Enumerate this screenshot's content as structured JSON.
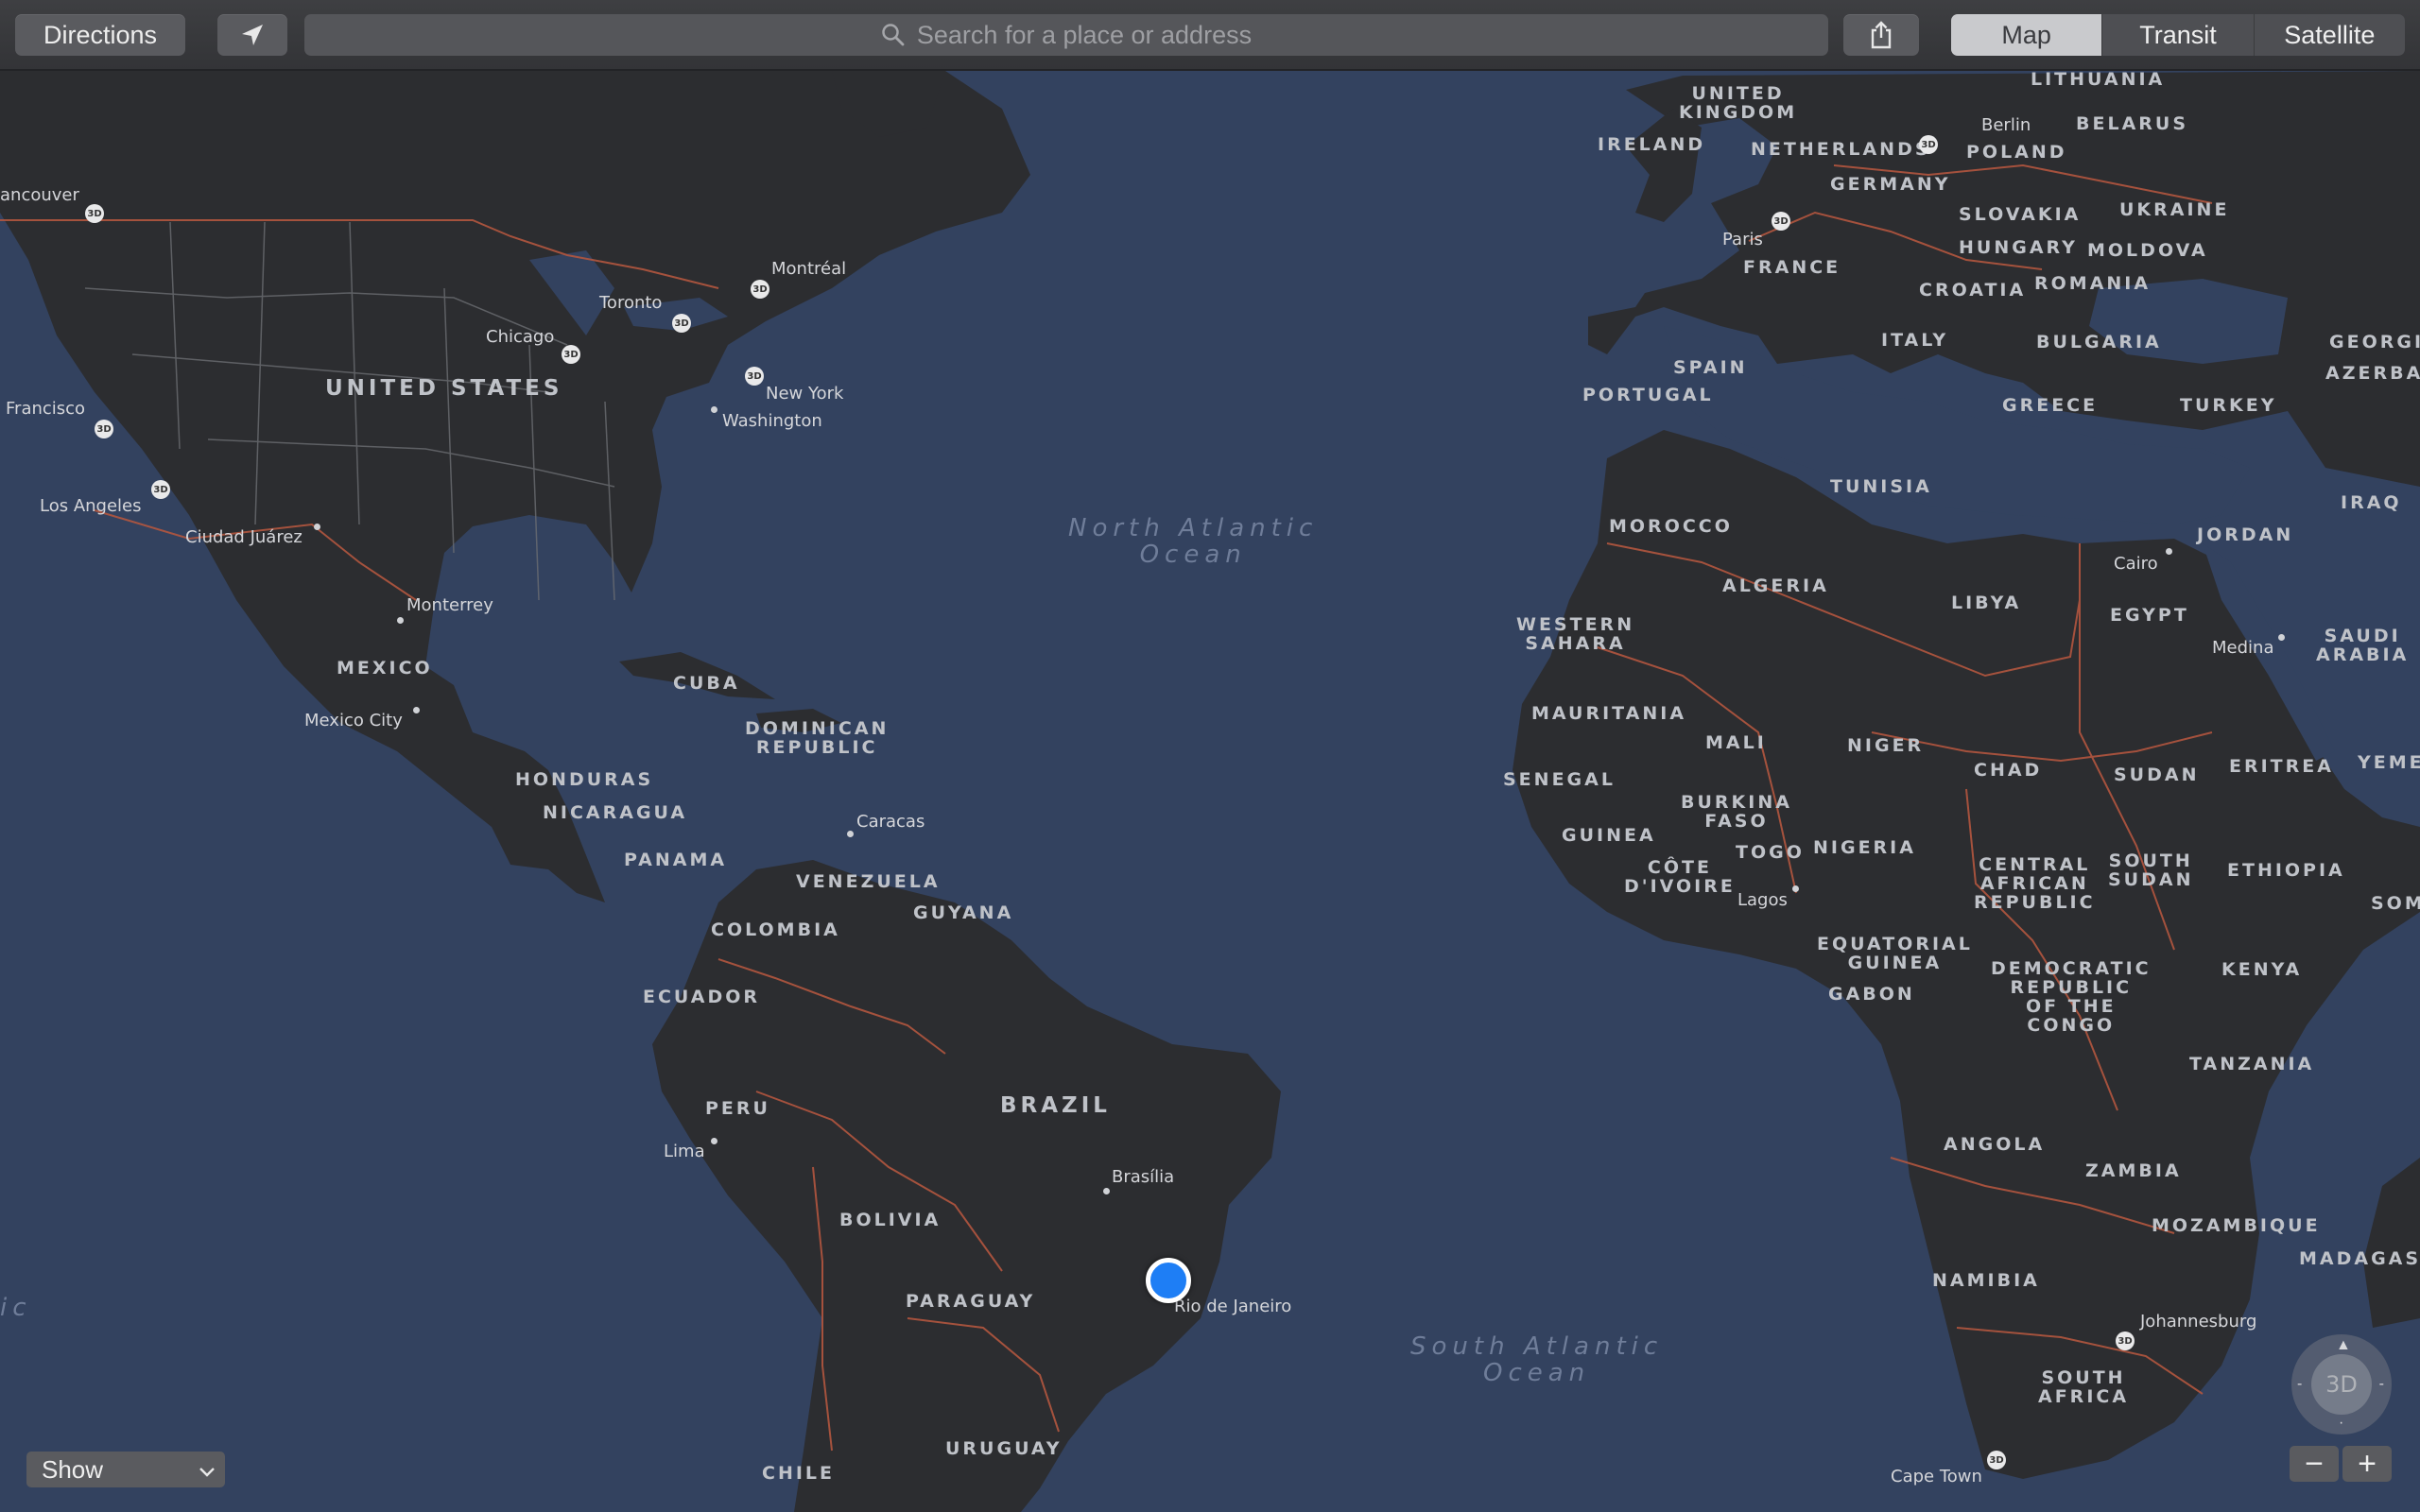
{
  "toolbar": {
    "directions_label": "Directions",
    "search_placeholder": "Search for a place or address",
    "map_types": [
      {
        "label": "Map",
        "active": true
      },
      {
        "label": "Transit",
        "active": false
      },
      {
        "label": "Satellite",
        "active": false
      }
    ],
    "icons": {
      "location": "location-arrow-icon",
      "search": "magnifier-icon",
      "share": "share-icon"
    }
  },
  "map": {
    "colors": {
      "ocean": "#33425f",
      "land": "#2c2d30",
      "border": "#b3563f",
      "user_location": "#1e7ef5"
    },
    "user_location_label": "Rio de Janeiro",
    "oceans": [
      {
        "line1": "North Atlantic",
        "line2": "Ocean"
      },
      {
        "line1": "South Atlantic",
        "line2": "Ocean"
      },
      {
        "fragment": "ic"
      }
    ],
    "countries": [
      "UNITED STATES",
      "MEXICO",
      "CUBA",
      "DOMINICAN",
      "REPUBLIC",
      "HONDURAS",
      "NICARAGUA",
      "PANAMA",
      "VENEZUELA",
      "GUYANA",
      "COLOMBIA",
      "ECUADOR",
      "PERU",
      "BRAZIL",
      "BOLIVIA",
      "PARAGUAY",
      "URUGUAY",
      "CHILE",
      "UNITED",
      "KINGDOM",
      "IRELAND",
      "NETHERLANDS",
      "GERMANY",
      "POLAND",
      "BELARUS",
      "LITHUANIA",
      "FRANCE",
      "SLOVAKIA",
      "UKRAINE",
      "HUNGARY",
      "MOLDOVA",
      "CROATIA",
      "ROMANIA",
      "ITALY",
      "BULGARIA",
      "GEORGIA",
      "AZERBAI",
      "SPAIN",
      "PORTUGAL",
      "GREECE",
      "TURKEY",
      "TUNISIA",
      "MOROCCO",
      "ALGERIA",
      "LIBYA",
      "EGYPT",
      "IRAQ",
      "JORDAN",
      "SAUDI",
      "ARABIA",
      "WESTERN",
      "SAHARA",
      "MAURITANIA",
      "MALI",
      "NIGER",
      "CHAD",
      "SUDAN",
      "ERITREA",
      "YEMEN",
      "SENEGAL",
      "BURKINA",
      "FASO",
      "GUINEA",
      "CÔTE",
      "D'IVOIRE",
      "TOGO",
      "NIGERIA",
      "CENTRAL",
      "AFRICAN",
      "REPUBLIC",
      "SOUTH",
      "SUDAN",
      "ETHIOPIA",
      "SOMALI",
      "EQUATORIAL",
      "GUINEA",
      "GABON",
      "DEMOCRATIC",
      "REPUBLIC",
      "OF THE",
      "CONGO",
      "KENYA",
      "TANZANIA",
      "ANGOLA",
      "ZAMBIA",
      "MOZAMBIQUE",
      "MADAGASC",
      "NAMIBIA",
      "SOUTH",
      "AFRICA"
    ],
    "cities": [
      "ancouver",
      "Francisco",
      "Los Angeles",
      "Ciudad Juárez",
      "Monterrey",
      "Mexico City",
      "Chicago",
      "Toronto",
      "Montréal",
      "New York",
      "Washington",
      "Caracas",
      "Lima",
      "Brasília",
      "Rio de Janeiro",
      "Berlin",
      "Paris",
      "Cairo",
      "Medina",
      "Lagos",
      "Johannesburg",
      "Cape Town"
    ],
    "badge_3d": "3D"
  },
  "controls": {
    "show_label": "Show",
    "compass_label": "3D",
    "zoom_out": "−",
    "zoom_in": "+"
  }
}
